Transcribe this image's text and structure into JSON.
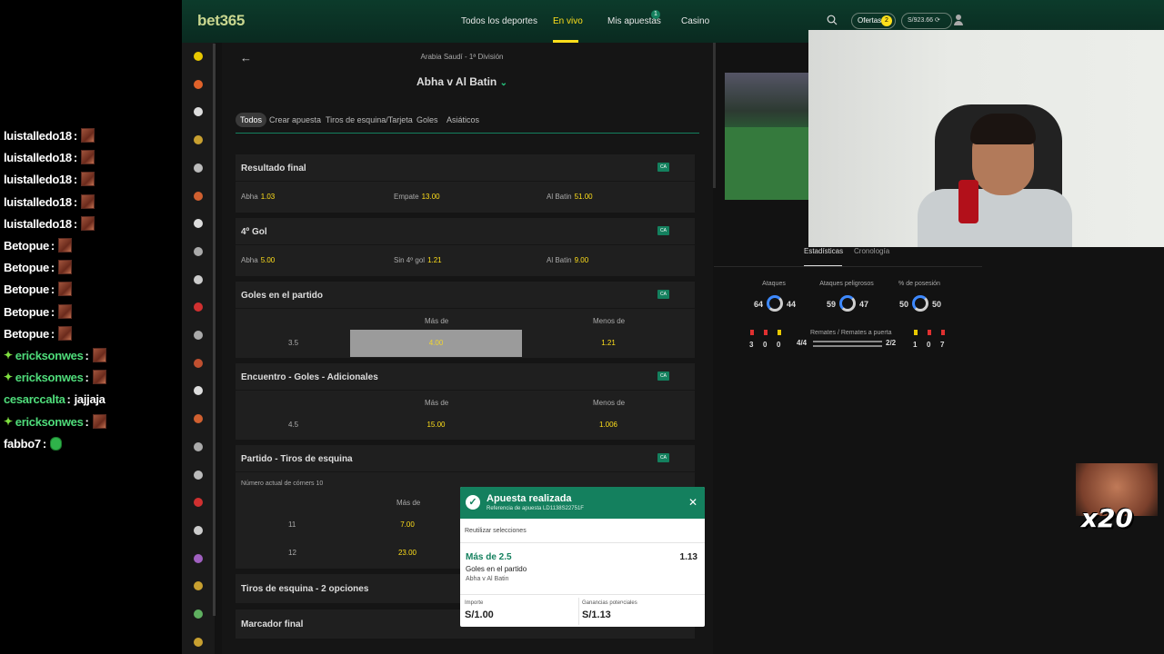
{
  "chat": {
    "lines": [
      {
        "user": "luistalledo18",
        "color": "#ffffff",
        "badge": false,
        "emote": "brown",
        "msg": ""
      },
      {
        "user": "luistalledo18",
        "color": "#ffffff",
        "badge": false,
        "emote": "brown",
        "msg": ""
      },
      {
        "user": "luistalledo18",
        "color": "#ffffff",
        "badge": false,
        "emote": "brown",
        "msg": ""
      },
      {
        "user": "luistalledo18",
        "color": "#ffffff",
        "badge": false,
        "emote": "brown",
        "msg": ""
      },
      {
        "user": "luistalledo18",
        "color": "#ffffff",
        "badge": false,
        "emote": "brown",
        "msg": ""
      },
      {
        "user": "Betopue",
        "color": "#ffffff",
        "badge": false,
        "emote": "brown",
        "msg": ""
      },
      {
        "user": "Betopue",
        "color": "#ffffff",
        "badge": false,
        "emote": "brown",
        "msg": ""
      },
      {
        "user": "Betopue",
        "color": "#ffffff",
        "badge": false,
        "emote": "brown",
        "msg": ""
      },
      {
        "user": "Betopue",
        "color": "#ffffff",
        "badge": false,
        "emote": "brown",
        "msg": ""
      },
      {
        "user": "Betopue",
        "color": "#ffffff",
        "badge": false,
        "emote": "brown",
        "msg": ""
      },
      {
        "user": "ericksonwes",
        "color": "#4fdc7a",
        "badge": true,
        "emote": "brown",
        "msg": ""
      },
      {
        "user": "ericksonwes",
        "color": "#4fdc7a",
        "badge": true,
        "emote": "brown",
        "msg": ""
      },
      {
        "user": "cesarccalta",
        "color": "#4fdc7a",
        "badge": false,
        "emote": "",
        "msg": "jajjaja"
      },
      {
        "user": "ericksonwes",
        "color": "#4fdc7a",
        "badge": true,
        "emote": "brown",
        "msg": ""
      },
      {
        "user": "fabbo7",
        "color": "#ffffff",
        "badge": false,
        "emote": "green",
        "msg": ""
      }
    ]
  },
  "topbar": {
    "logo": "bet365",
    "nav": [
      "Todos los deportes",
      "En vivo",
      "Mis apuestas",
      "Casino"
    ],
    "active_nav": "En vivo",
    "my_bets_count": "1",
    "offers_label": "Ofertas",
    "offers_count": "2",
    "balance": "S/923.66"
  },
  "match": {
    "league": "Arabia Saudí - 1ª División",
    "title": "Abha v Al Batin",
    "tabs": [
      "Todos",
      "Crear apuesta",
      "Tiros de esquina/Tarjeta",
      "Goles",
      "Asiáticos"
    ],
    "active_tab": "Todos",
    "markets": {
      "final_result": {
        "title": "Resultado final",
        "badge": "CA",
        "odds": [
          {
            "label": "Abha",
            "price": "1.03"
          },
          {
            "label": "Empate",
            "price": "13.00"
          },
          {
            "label": "Al Batin",
            "price": "51.00"
          }
        ]
      },
      "fourth_goal": {
        "title": "4º Gol",
        "badge": "CA",
        "odds": [
          {
            "label": "Abha",
            "price": "5.00"
          },
          {
            "label": "Sin 4º gol",
            "price": "1.21"
          },
          {
            "label": "Al Batin",
            "price": "9.00"
          }
        ]
      },
      "match_goals": {
        "title": "Goles en el partido",
        "badge": "CA",
        "over": "Más de",
        "under": "Menos de",
        "line": "3.5",
        "over_price": "4.00",
        "under_price": "1.21"
      },
      "extra_goals": {
        "title": "Encuentro - Goles - Adicionales",
        "badge": "CA",
        "over": "Más de",
        "under": "Menos de",
        "line": "4.5",
        "over_price": "15.00",
        "under_price": "1.006"
      },
      "corners": {
        "title": "Partido - Tiros de esquina",
        "badge": "CA",
        "note": "Número actual de córners 10",
        "over": "Más de",
        "rows": [
          {
            "line": "11",
            "price": "7.00"
          },
          {
            "line": "12",
            "price": "23.00"
          }
        ]
      },
      "corners_2way": {
        "title": "Tiros de esquina - 2 opciones"
      },
      "correct_score": {
        "title": "Marcador final"
      }
    }
  },
  "stats": {
    "tab_stats": "Estadísticas",
    "tab_timeline": "Cronología",
    "attacks_label": "Ataques",
    "attacks_home": "64",
    "attacks_away": "44",
    "danger_label": "Ataques peligrosos",
    "danger_home": "59",
    "danger_away": "47",
    "possession_label": "% de posesión",
    "possession_home": "50",
    "possession_away": "50",
    "shots_label": "Remates / Remates a puerta",
    "shots_home": "4/4",
    "shots_away": "2/2",
    "home_cards": [
      "3",
      "0",
      "0"
    ],
    "away_cards": [
      "1",
      "0",
      "7"
    ]
  },
  "slip": {
    "title": "Apuesta realizada",
    "reference": "Referencia de apuesta LD1138S22751F",
    "reuse": "Reutilizar selecciones",
    "selection": "Más de 2.5",
    "price": "1.13",
    "market": "Goles en el partido",
    "event": "Abha v Al Batin",
    "stake_label": "Importe",
    "stake": "S/1.00",
    "returns_label": "Ganancias potenciales",
    "returns": "S/1.13"
  },
  "overlay": {
    "combo": "x20"
  },
  "colors": {
    "brand_green": "#14805e",
    "odds_yellow": "#ffdf1b",
    "header_green": "#0c3b2b"
  }
}
